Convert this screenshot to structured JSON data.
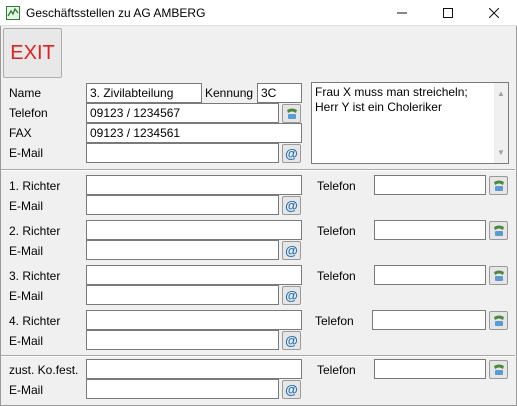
{
  "window": {
    "title": "Geschäftsstellen zu AG AMBERG",
    "controls": {
      "minimize": "–",
      "maximize": "☐",
      "close": "✕"
    }
  },
  "toolbar": {
    "exit_label": "EXIT"
  },
  "office": {
    "name_label": "Name",
    "name_value": "3. Zivilabteilung",
    "kennung_label": "Kennung",
    "kennung_value": "3C",
    "telefon_label": "Telefon",
    "telefon_value": "09123 / 1234567",
    "fax_label": "FAX",
    "fax_value": "09123 / 1234561",
    "email_label": "E-Mail",
    "email_value": "",
    "notes": [
      "Frau X muss man streicheln;",
      "Herr Y ist ein Choleriker"
    ]
  },
  "judges": [
    {
      "label": "1. Richter",
      "name_value": "",
      "email_label": "E-Mail",
      "email_value": "",
      "phone_label": "Telefon",
      "phone_value": ""
    },
    {
      "label": "2. Richter",
      "name_value": "",
      "email_label": "E-Mail",
      "email_value": "",
      "phone_label": "Telefon",
      "phone_value": ""
    },
    {
      "label": "3. Richter",
      "name_value": "",
      "email_label": "E-Mail",
      "email_value": "",
      "phone_label": "Telefon",
      "phone_value": ""
    },
    {
      "label": "4. Richter",
      "name_value": "",
      "email_label": "E-Mail",
      "email_value": "",
      "phone_label": "Telefon",
      "phone_value": ""
    }
  ],
  "kofest": {
    "label": "zust. Ko.fest.",
    "name_value": "",
    "email_label": "E-Mail",
    "email_value": "",
    "phone_label": "Telefon",
    "phone_value": ""
  },
  "icons": {
    "email": "@",
    "phone": "phone-icon",
    "app": "app-icon"
  },
  "colors": {
    "exit_text": "#e02020",
    "at_sign": "#1f6fb3"
  }
}
